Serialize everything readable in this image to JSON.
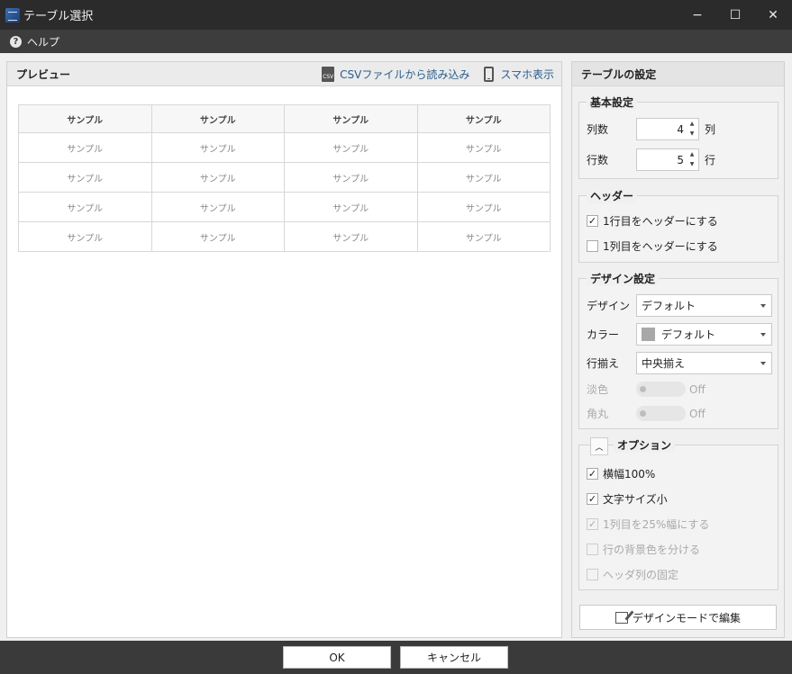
{
  "window": {
    "title": "テーブル選択",
    "minimize": "−",
    "maximize": "☐",
    "close": "✕"
  },
  "menu": {
    "help_icon": "?",
    "help_label": "ヘルプ"
  },
  "preview": {
    "title": "プレビュー",
    "csv_icon_text": "CSV",
    "csv_label": "CSVファイルから読み込み",
    "mobile_label": "スマホ表示",
    "table": {
      "headers": [
        "サンプル",
        "サンプル",
        "サンプル",
        "サンプル"
      ],
      "rows": [
        [
          "サンプル",
          "サンプル",
          "サンプル",
          "サンプル"
        ],
        [
          "サンプル",
          "サンプル",
          "サンプル",
          "サンプル"
        ],
        [
          "サンプル",
          "サンプル",
          "サンプル",
          "サンプル"
        ],
        [
          "サンプル",
          "サンプル",
          "サンプル",
          "サンプル"
        ]
      ]
    }
  },
  "settings": {
    "title": "テーブルの設定",
    "basic": {
      "legend": "基本設定",
      "columns_label": "列数",
      "columns_value": "4",
      "columns_unit": "列",
      "rows_label": "行数",
      "rows_value": "5",
      "rows_unit": "行"
    },
    "header": {
      "legend": "ヘッダー",
      "first_row": {
        "label": "1行目をヘッダーにする",
        "checked": "✓"
      },
      "first_col": {
        "label": "1列目をヘッダーにする",
        "checked": ""
      }
    },
    "design": {
      "legend": "デザイン設定",
      "design_label": "デザイン",
      "design_value": "デフォルト",
      "color_label": "カラー",
      "color_value": "デフォルト",
      "color_swatch": "#a8a8a8",
      "align_label": "行揃え",
      "align_value": "中央揃え",
      "light_label": "淡色",
      "light_value": "Off",
      "round_label": "角丸",
      "round_value": "Off"
    },
    "options": {
      "legend": "オプション",
      "collapse_icon": "︿",
      "items": [
        {
          "label": "横幅100%",
          "checked": "✓"
        },
        {
          "label": "文字サイズ小",
          "checked": "✓"
        },
        {
          "label": "1列目を25%幅にする",
          "checked": "✓"
        },
        {
          "label": "行の背景色を分ける",
          "checked": ""
        },
        {
          "label": "ヘッダ列の固定",
          "checked": ""
        }
      ]
    },
    "design_mode_button": "デザインモードで編集"
  },
  "footer": {
    "ok": "OK",
    "cancel": "キャンセル"
  }
}
